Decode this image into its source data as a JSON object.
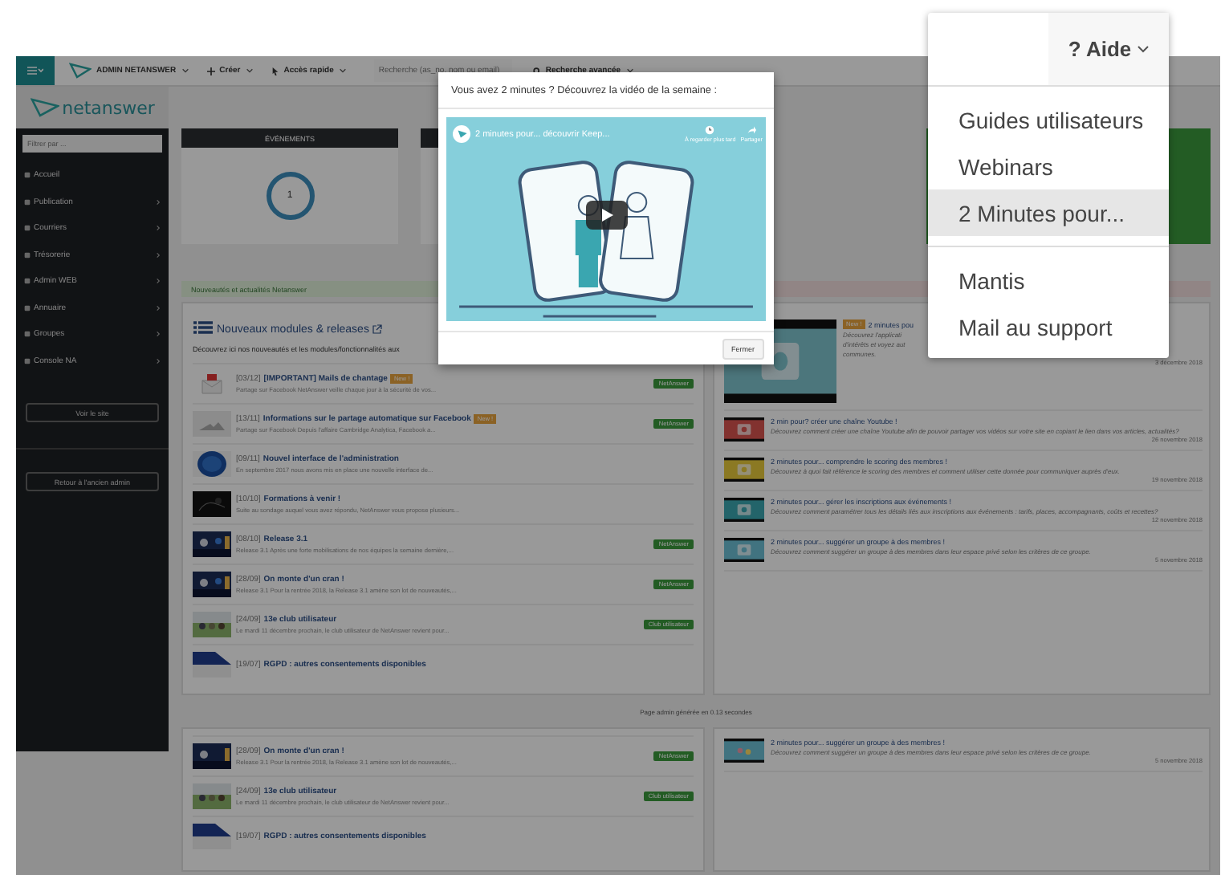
{
  "topbar": {
    "brand": "ADMIN NETANSWER",
    "menus": [
      "Créer",
      "Accès rapide"
    ],
    "search": {
      "placeholder": "Recherche (as_no, nom ou email)"
    },
    "advanced_search": "Recherche avancée"
  },
  "sidebar": {
    "logo": "netanswer",
    "filter": {
      "placeholder": "Filtrer par ..."
    },
    "items": [
      {
        "label": "Accueil",
        "has_submenu": false
      },
      {
        "label": "Publication",
        "has_submenu": true
      },
      {
        "label": "Courriers",
        "has_submenu": true
      },
      {
        "label": "Trésorerie",
        "has_submenu": true
      },
      {
        "label": "Admin WEB",
        "has_submenu": true
      },
      {
        "label": "Annuaire",
        "has_submenu": true
      },
      {
        "label": "Groupes",
        "has_submenu": true
      },
      {
        "label": "Console NA",
        "has_submenu": true
      }
    ],
    "site_button": "Voir le site",
    "back_button": "Retour à l'ancien admin"
  },
  "stats": {
    "title": "ÉVÉNEMENTS",
    "count": "1"
  },
  "alert": "Nouveautés et actualités Netanswer",
  "releases": {
    "title": "Nouveaux modules & releases",
    "intro": "Découvrez ici nos nouveautés et les modules/fonctionnalités aux",
    "items": [
      {
        "date": "[03/12]",
        "title": "[IMPORTANT] Mails de chantage",
        "badge": "New !",
        "excerpt": "Partage sur Facebook NetAnswer veille chaque jour à la sécurité de vos...",
        "tag": "NetAnswer"
      },
      {
        "date": "[13/11]",
        "title": "Informations sur le partage automatique sur Facebook",
        "badge": "New !",
        "excerpt": "Partage sur Facebook Depuis l'affaire Cambridge Analytica, Facebook a...",
        "tag": "NetAnswer"
      },
      {
        "date": "[09/11]",
        "title": "Nouvel interface de l'administration",
        "excerpt": "En septembre 2017 nous avons mis en place une nouvelle interface de..."
      },
      {
        "date": "[10/10]",
        "title": "Formations à venir !",
        "excerpt": "Suite au sondage auquel vous avez répondu, NetAnswer vous propose plusieurs..."
      },
      {
        "date": "[08/10]",
        "title": "Release 3.1",
        "excerpt": "Release 3.1 Après une forte mobilisations de nos équipes la semaine dernière,...",
        "tag": "NetAnswer"
      },
      {
        "date": "[28/09]",
        "title": "On monte d'un cran !",
        "excerpt": "Release 3.1 Pour la rentrée 2018, la Release 3.1 amène son lot de nouveautés,...",
        "tag": "NetAnswer"
      },
      {
        "date": "[24/09]",
        "title": "13e club utilisateur",
        "excerpt": "Le mardi 11 décembre prochain, le club utilisateur de NetAnswer revient pour...",
        "tag": "Club utilisateur"
      },
      {
        "date": "[19/07]",
        "title": "RGPD : autres consentements disponibles"
      }
    ]
  },
  "videos": {
    "items": [
      {
        "badge": "New !",
        "title": "2 minutes pou",
        "text": "Découvrez l'applicati",
        "text_2": "d'intérêts et voyez aut",
        "text_3": "communes.",
        "date": "3 décembre 2018"
      },
      {
        "title": "2 min pour? créer une chaîne Youtube !",
        "text": "Découvrez comment créer une chaîne Youtube afin de pouvoir partager vos vidéos sur votre site en copiant le lien dans vos articles, actualités?",
        "date": "26 novembre 2018"
      },
      {
        "title": "2 minutes pour... comprendre le scoring des membres !",
        "text": "Découvrez à quoi fait référence le scoring des membres et comment utiliser cette donnée pour communiquer auprès d'eux.",
        "date": "19 novembre 2018"
      },
      {
        "title": "2 minutes pour... gérer les inscriptions aux événements !",
        "text": "Découvrez comment paramétrer tous les détails liés aux inscriptions aux événements : tarifs, places, accompagnants, coûts et recettes?",
        "date": "12 novembre 2018"
      },
      {
        "title": "2 minutes pour... suggérer un groupe à des membres !",
        "text": "Découvrez comment suggérer un groupe à des membres dans leur espace privé selon les critères de ce groupe.",
        "date": "5 novembre 2018"
      }
    ]
  },
  "footer": "Page admin générée en 0.13 secondes",
  "lower": {
    "releases": [
      {
        "date": "[28/09]",
        "title": "On monte d'un cran !",
        "excerpt": "Release 3.1 Pour la rentrée 2018, la Release 3.1 amène son lot de nouveautés,...",
        "tag": "NetAnswer"
      },
      {
        "date": "[24/09]",
        "title": "13e club utilisateur",
        "excerpt": "Le mardi 11 décembre prochain, le club utilisateur de NetAnswer revient pour...",
        "tag": "Club utilisateur"
      },
      {
        "date": "[19/07]",
        "title": "RGPD : autres consentements disponibles"
      }
    ],
    "videos": [
      {
        "title": "2 minutes pour... suggérer un groupe à des membres !",
        "text": "Découvrez comment suggérer un groupe à des membres dans leur espace privé selon les critères de ce groupe.",
        "date": "5 novembre 2018"
      }
    ]
  },
  "modal": {
    "title": "Vous avez 2 minutes ? Découvrez la vidéo de la semaine :",
    "video": {
      "title": "2 minutes pour... découvrir Keep...",
      "watch_later": "À regarder plus tard",
      "share": "Partager"
    },
    "close_button": "Fermer"
  },
  "help_menu": {
    "button": "? Aide",
    "items": [
      {
        "label": "Guides utilisateurs",
        "selected": false,
        "divider_before": false
      },
      {
        "label": "Webinars",
        "selected": false,
        "divider_before": false
      },
      {
        "label": "2 Minutes pour...",
        "selected": true,
        "divider_before": false
      },
      {
        "label": "Mantis",
        "selected": false,
        "divider_before": true
      },
      {
        "label": "Mail au support",
        "selected": false,
        "divider_before": false
      }
    ]
  }
}
